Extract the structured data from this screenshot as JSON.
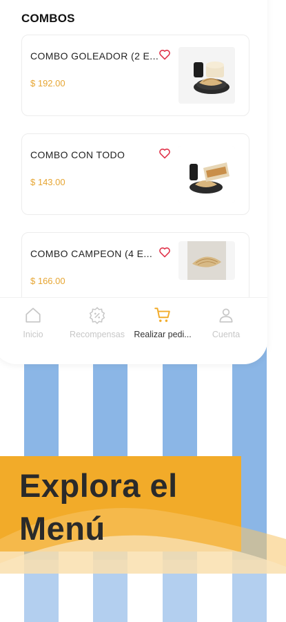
{
  "colors": {
    "stripe_blue": "#8bb6e6",
    "stripe_light_blue": "#cfe0f4",
    "banner_orange": "#f2ab29",
    "price_color": "#e6a532",
    "heart_color": "#e0334a",
    "nav_active": "#f2ab29",
    "nav_inactive": "#c7c7c7"
  },
  "section": {
    "title": "COMBOS"
  },
  "combos": [
    {
      "name": "COMBO GOLEADOR (2 E...",
      "price": "$ 192.00",
      "favorite_icon": "heart-outline-icon",
      "image": "combo-goleador-photo"
    },
    {
      "name": "COMBO CON TODO",
      "price": "$ 143.00",
      "favorite_icon": "heart-outline-icon",
      "image": "combo-con-todo-photo"
    },
    {
      "name": "COMBO CAMPEON (4 E...",
      "price": "$ 166.00",
      "favorite_icon": "heart-outline-icon",
      "image": "combo-campeon-photo"
    }
  ],
  "nav": {
    "items": [
      {
        "label": "Inicio",
        "icon": "home-icon",
        "active": false
      },
      {
        "label": "Recompensas",
        "icon": "percent-badge-icon",
        "active": false
      },
      {
        "label": "Realizar pedi...",
        "icon": "cart-icon",
        "active": true
      },
      {
        "label": "Cuenta",
        "icon": "user-icon",
        "active": false
      }
    ]
  },
  "banner": {
    "line1": "Explora el",
    "line2": "Menú"
  }
}
